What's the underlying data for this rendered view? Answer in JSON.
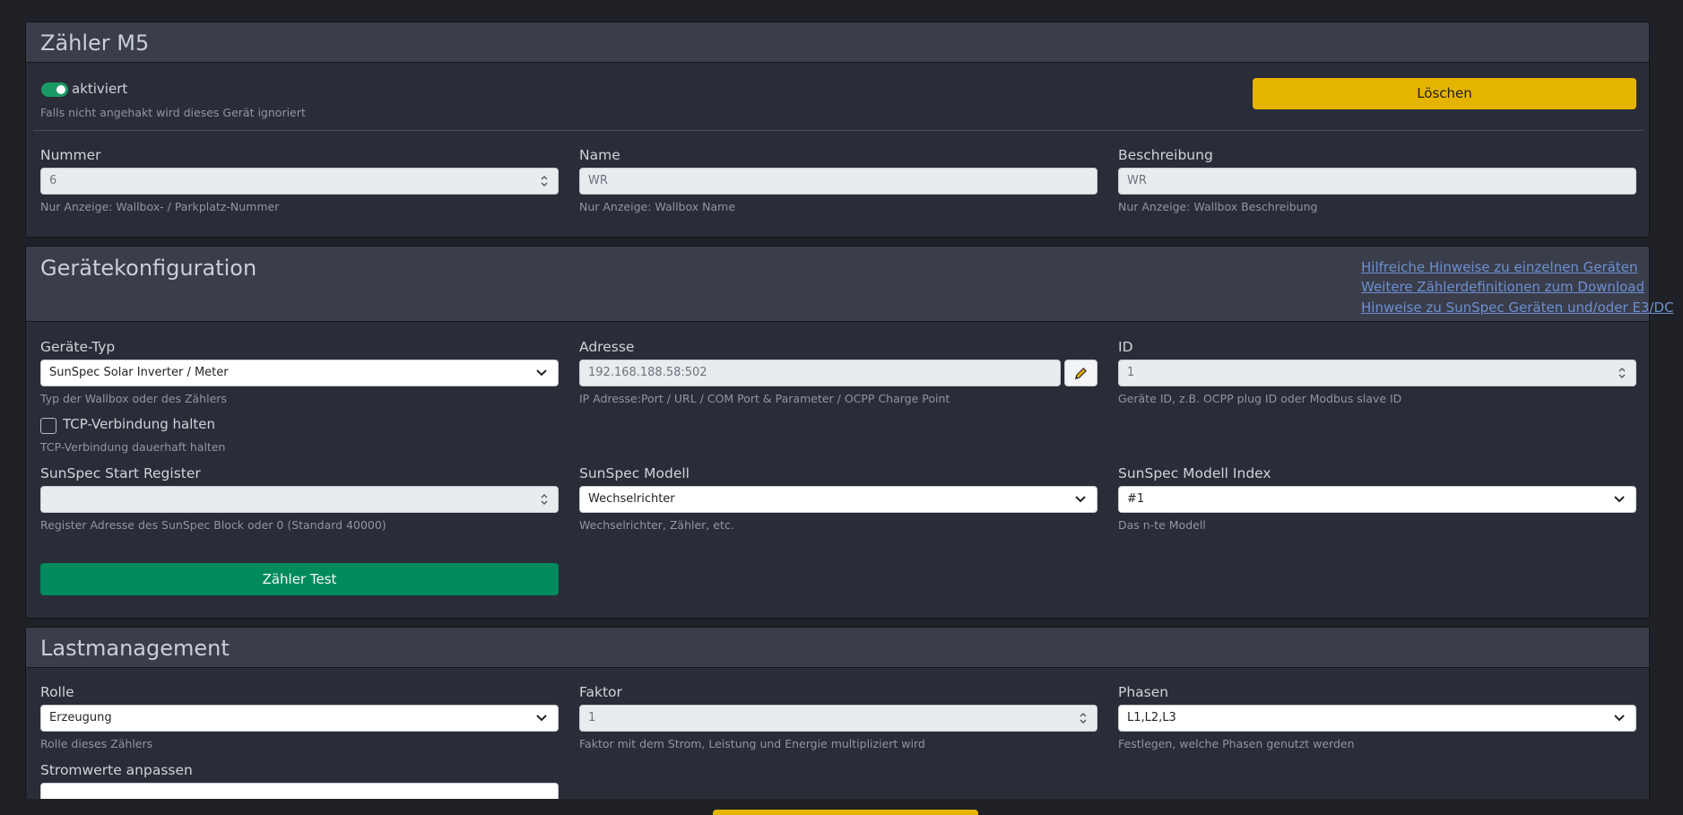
{
  "meter": {
    "title": "Zähler M5",
    "enabled_label": "aktiviert",
    "enabled_help": "Falls nicht angehakt wird dieses Gerät ignoriert",
    "delete_button": "Löschen",
    "number": {
      "label": "Nummer",
      "value": "6",
      "help": "Nur Anzeige: Wallbox- / Parkplatz-Nummer"
    },
    "name": {
      "label": "Name",
      "value": "WR",
      "help": "Nur Anzeige: Wallbox Name"
    },
    "description": {
      "label": "Beschreibung",
      "value": "WR",
      "help": "Nur Anzeige: Wallbox Beschreibung"
    }
  },
  "device_config": {
    "title": "Gerätekonfiguration",
    "links": [
      "Hilfreiche Hinweise zu einzelnen Geräten",
      "Weitere Zählerdefinitionen zum Download",
      "Hinweise zu SunSpec Geräten und/oder E3/DC"
    ],
    "device_type": {
      "label": "Geräte-Typ",
      "value": "SunSpec Solar Inverter / Meter",
      "help": "Typ der Wallbox oder des Zählers"
    },
    "address": {
      "label": "Adresse",
      "value": "192.168.188.58:502",
      "help": "IP Adresse:Port / URL / COM Port & Parameter / OCPP Charge Point"
    },
    "id": {
      "label": "ID",
      "value": "1",
      "help": "Geräte ID, z.B. OCPP plug ID oder Modbus slave ID"
    },
    "tcp_keep": {
      "label": "TCP-Verbindung halten",
      "help": "TCP-Verbindung dauerhaft halten"
    },
    "start_register": {
      "label": "SunSpec Start Register",
      "value": "",
      "help": "Register Adresse des SunSpec Block oder 0 (Standard 40000)"
    },
    "model": {
      "label": "SunSpec Modell",
      "value": "Wechselrichter",
      "help": "Wechselrichter, Zähler, etc."
    },
    "model_index": {
      "label": "SunSpec Modell Index",
      "value": "#1",
      "help": "Das n-te Modell"
    },
    "test_button": "Zähler Test"
  },
  "load_management": {
    "title": "Lastmanagement",
    "role": {
      "label": "Rolle",
      "value": "Erzeugung",
      "help": "Rolle dieses Zählers"
    },
    "factor": {
      "label": "Faktor",
      "value": "1",
      "help": "Faktor mit dem Strom, Leistung und Energie multipliziert wird"
    },
    "phases": {
      "label": "Phasen",
      "value": "L1,L2,L3",
      "help": "Festlegen, welche Phasen genutzt werden"
    },
    "adjust_current": {
      "label": "Stromwerte anpassen"
    }
  },
  "colors": {
    "background": "#1f2126",
    "card": "#2a2c37",
    "card_header": "#3a3e4b",
    "warning": "#e5b400",
    "success": "#008b5e",
    "link": "#6d8fd2"
  },
  "icons": {
    "edit": "pencil-icon",
    "select": "chevron-down-icon",
    "number": "spinner-arrows-icon"
  }
}
